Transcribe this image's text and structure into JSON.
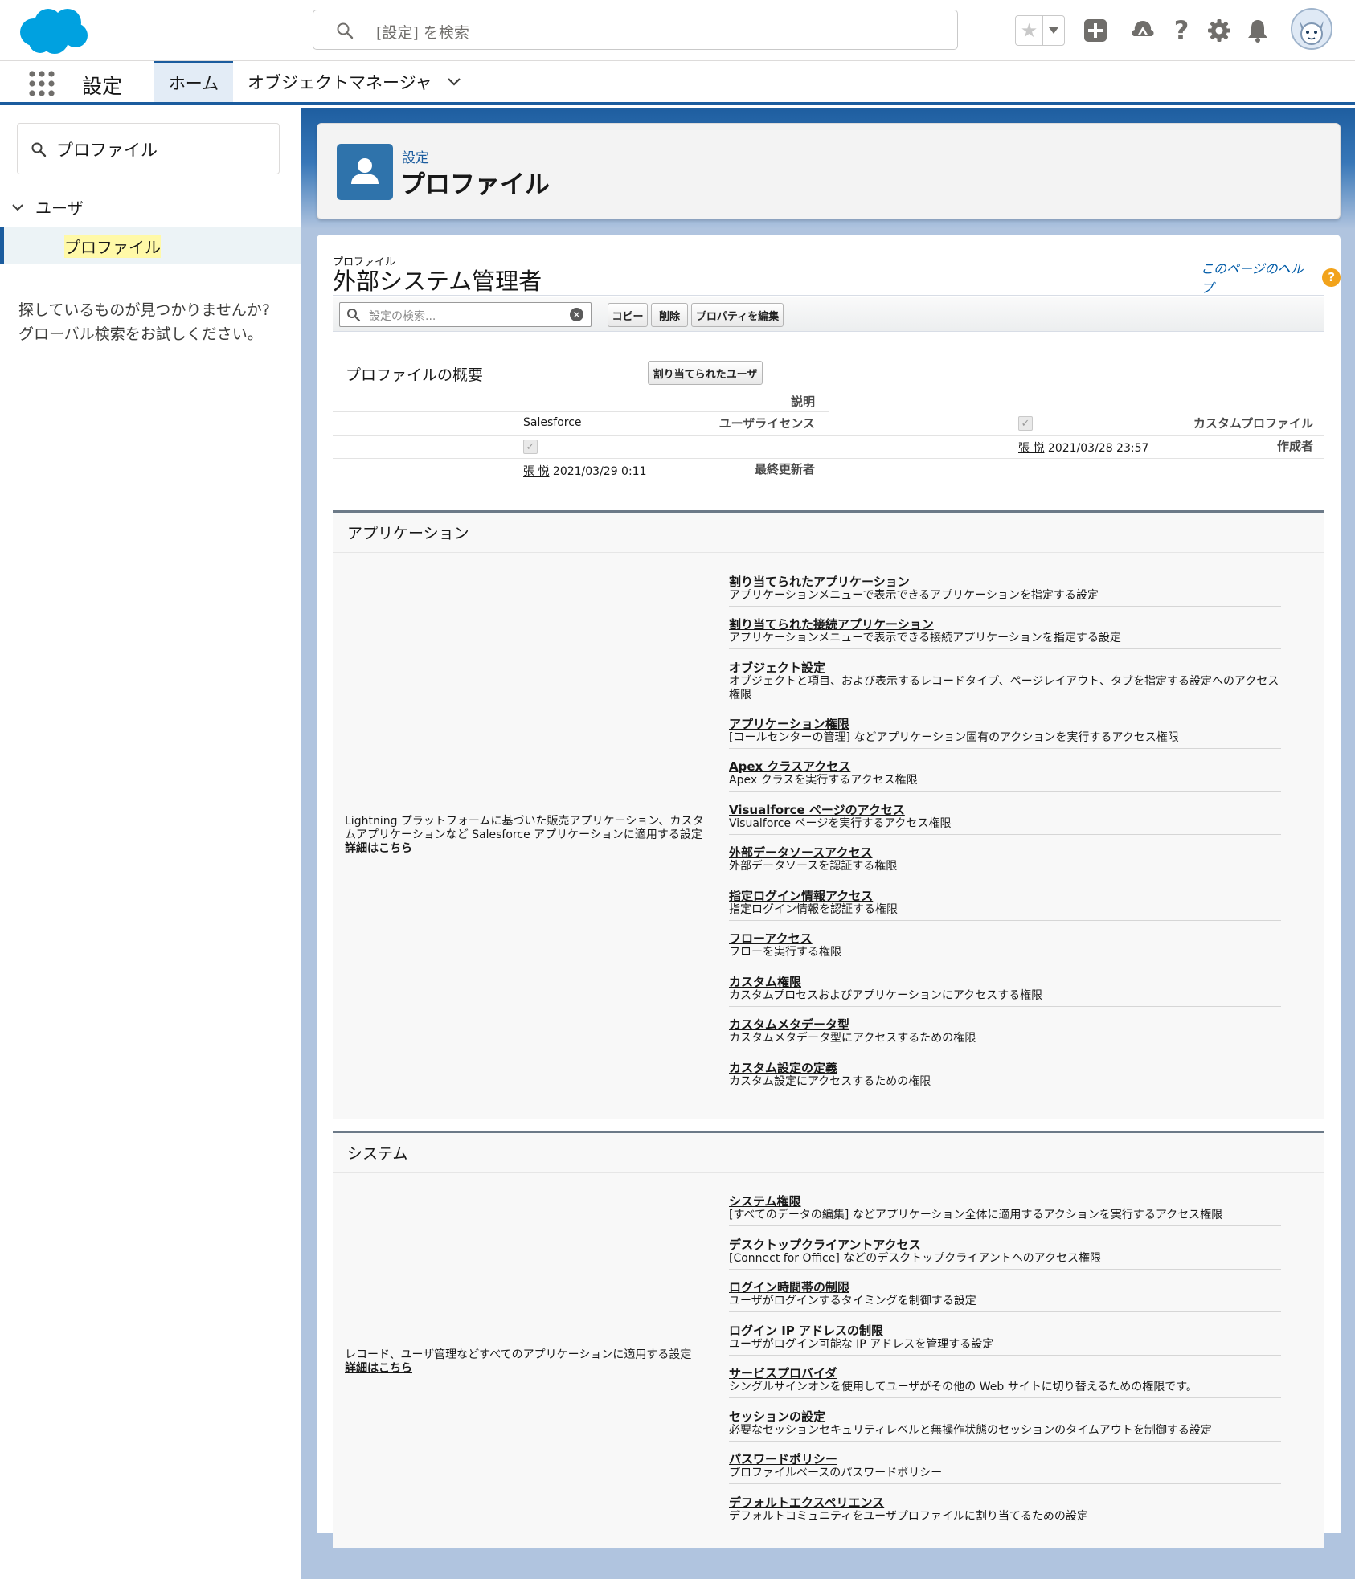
{
  "header": {
    "search_placeholder": "[設定] を検索"
  },
  "context": {
    "app_name": "設定",
    "tabs": [
      {
        "label": "ホーム"
      },
      {
        "label": "オブジェクトマネージャ"
      }
    ]
  },
  "sidebar": {
    "quickfind_value": "プロファイル",
    "tree_parent": "ユーザ",
    "tree_item": "プロファイル",
    "not_found_line1": "探しているものが見つかりませんか?",
    "not_found_line2": "グローバル検索をお試しください。"
  },
  "page_header": {
    "breadcrumb": "設定",
    "title": "プロファイル"
  },
  "profile": {
    "type_label": "プロファイル",
    "name": "外部システム管理者",
    "help_link": "このページのヘルプ",
    "search_placeholder": "設定の検索...",
    "buttons": {
      "copy": "コピー",
      "delete": "削除",
      "edit_properties": "プロパティを編集"
    },
    "overview_title": "プロファイルの概要",
    "assigned_users_button": "割り当てられたユーザ",
    "fields": {
      "description_label": "説明",
      "license_label": "ユーザライセンス",
      "license_value": "Salesforce",
      "custom_label": "カスタムプロファイル",
      "created_label": "作成者",
      "created_user": "張 悦",
      "created_date": "2021/03/28 23:57",
      "modified_label": "最終更新者",
      "modified_user": "張 悦",
      "modified_date": "2021/03/29 0:11"
    }
  },
  "apps_section": {
    "title": "アプリケーション",
    "description": "Lightning プラットフォームに基づいた販売アプリケーション、カスタムアプリケーションなど Salesforce アプリケーションに適用する設定",
    "more": "詳細はこちら",
    "items": [
      {
        "title": "割り当てられたアプリケーション",
        "desc": "アプリケーションメニューで表示できるアプリケーションを指定する設定"
      },
      {
        "title": "割り当てられた接続アプリケーション",
        "desc": "アプリケーションメニューで表示できる接続アプリケーションを指定する設定"
      },
      {
        "title": "オブジェクト設定",
        "desc": "オブジェクトと項目、および表示するレコードタイプ、ページレイアウト、タブを指定する設定へのアクセス権限"
      },
      {
        "title": "アプリケーション権限",
        "desc": "[コールセンターの管理] などアプリケーション固有のアクションを実行するアクセス権限"
      },
      {
        "title": "Apex クラスアクセス",
        "desc": "Apex クラスを実行するアクセス権限"
      },
      {
        "title": "Visualforce ページのアクセス",
        "desc": "Visualforce ページを実行するアクセス権限"
      },
      {
        "title": "外部データソースアクセス",
        "desc": "外部データソースを認証する権限"
      },
      {
        "title": "指定ログイン情報アクセス",
        "desc": "指定ログイン情報を認証する権限"
      },
      {
        "title": "フローアクセス",
        "desc": "フローを実行する権限"
      },
      {
        "title": "カスタム権限",
        "desc": "カスタムプロセスおよびアプリケーションにアクセスする権限"
      },
      {
        "title": "カスタムメタデータ型",
        "desc": "カスタムメタデータ型にアクセスするための権限"
      },
      {
        "title": "カスタム設定の定義",
        "desc": "カスタム設定にアクセスするための権限"
      }
    ]
  },
  "system_section": {
    "title": "システム",
    "description": "レコード、ユーザ管理などすべてのアプリケーションに適用する設定",
    "more": "詳細はこちら",
    "items": [
      {
        "title": "システム権限",
        "desc": "[すべてのデータの編集] などアプリケーション全体に適用するアクションを実行するアクセス権限"
      },
      {
        "title": "デスクトップクライアントアクセス",
        "desc": "[Connect for Office] などのデスクトップクライアントへのアクセス権限"
      },
      {
        "title": "ログイン時間帯の制限",
        "desc": "ユーザがログインするタイミングを制御する設定"
      },
      {
        "title": "ログイン IP アドレスの制限",
        "desc": "ユーザがログイン可能な IP アドレスを管理する設定"
      },
      {
        "title": "サービスプロバイダ",
        "desc": "シングルサインオンを使用してユーザがその他の Web サイトに切り替えるための権限です。"
      },
      {
        "title": "セッションの設定",
        "desc": "必要なセッションセキュリティレベルと無操作状態のセッションのタイムアウトを制御する設定"
      },
      {
        "title": "パスワードポリシー",
        "desc": "プロファイルベースのパスワードポリシー"
      },
      {
        "title": "デフォルトエクスペリエンス",
        "desc": "デフォルトコミュニティをユーザプロファイルに割り当てるための設定"
      }
    ]
  },
  "colors": {
    "brand_blue": "#1b5c9e",
    "logo_blue": "#00a1e0",
    "link_blue": "#015ba7",
    "help_orange": "#f2a31b",
    "highlight_yellow": "#fff9a8"
  }
}
